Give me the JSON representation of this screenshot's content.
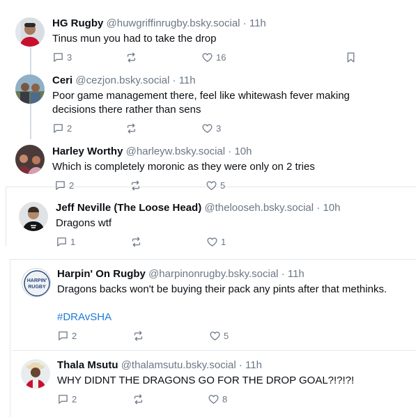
{
  "icons": {
    "reply": "reply-icon",
    "repost": "repost-icon",
    "like": "heart-icon",
    "bookmark": "bookmark-icon"
  },
  "posts": [
    {
      "name": "HG Rugby",
      "handle": "@huwgriffinrugby.bsky.social",
      "dot": "·",
      "time": "11h",
      "text": "Tinus mun you had to take the drop",
      "replies": "3",
      "reposts": "",
      "likes": "16"
    },
    {
      "name": "Ceri",
      "handle": "@cezjon.bsky.social",
      "dot": "·",
      "time": "11h",
      "text_line1": "Poor game management there, feel like whitewash fever making",
      "text_line2": "decisions there rather than sens",
      "replies": "2",
      "reposts": "",
      "likes": "3"
    },
    {
      "name": "Harley Worthy",
      "handle": "@harleyw.bsky.social",
      "dot": "·",
      "time": "10h",
      "text": "Which is completely moronic as they were only on 2 tries",
      "replies": "2",
      "reposts": "",
      "likes": "5"
    },
    {
      "name": "Jeff Neville (The Loose Head)",
      "handle": "@thelooseh.bsky.social",
      "dot": "·",
      "time": "10h",
      "text": "Dragons wtf",
      "replies": "1",
      "reposts": "",
      "likes": "1"
    },
    {
      "name": "Harpin' On Rugby",
      "handle": "@harpinonrugby.bsky.social",
      "dot": "·",
      "time": "11h",
      "text": "Dragons backs won't be buying their pack any pints after that methinks.",
      "hashtag": "#DRAvSHA",
      "avatar_text_1": "HARPIN'",
      "avatar_text_2": "RUGBY",
      "replies": "2",
      "reposts": "",
      "likes": "5"
    },
    {
      "name": "Thala Msutu",
      "handle": "@thalamsutu.bsky.social",
      "dot": "·",
      "time": "11h",
      "text": "WHY DIDNT THE DRAGONS GO FOR THE DROP GOAL?!?!?!",
      "replies": "2",
      "reposts": "",
      "likes": "8"
    }
  ]
}
